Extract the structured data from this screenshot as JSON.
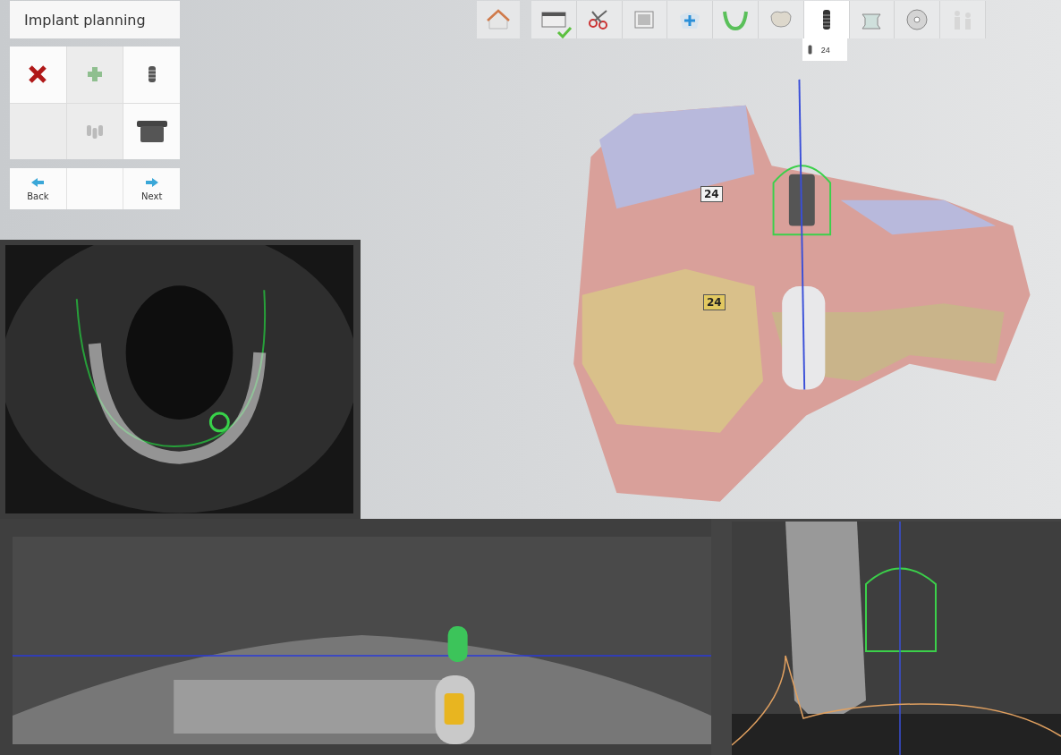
{
  "panel": {
    "title": "Implant planning"
  },
  "tools": [
    {
      "disabled": false
    },
    {
      "disabled": true
    },
    {
      "disabled": false
    },
    {
      "disabled": true
    },
    {
      "disabled": true
    },
    {
      "disabled": false
    }
  ],
  "navigation": [
    {
      "kind": "back",
      "label": "Back"
    },
    {
      "kind": "spacer"
    },
    {
      "kind": "next",
      "label": "Next"
    }
  ],
  "workflow_steps": [
    {
      "selected": false,
      "done": true
    },
    {
      "selected": false,
      "done": false
    },
    {
      "selected": false,
      "done": false
    },
    {
      "selected": false,
      "done": false
    },
    {
      "selected": false,
      "done": false
    },
    {
      "selected": false,
      "done": false
    },
    {
      "selected": true,
      "done": false,
      "tooltip": "24"
    },
    {
      "selected": false,
      "done": false
    },
    {
      "selected": false,
      "done": false
    },
    {
      "selected": false,
      "done": false,
      "disabled": true
    }
  ],
  "model_view": {
    "implant_labels": [
      "24",
      "24"
    ]
  }
}
